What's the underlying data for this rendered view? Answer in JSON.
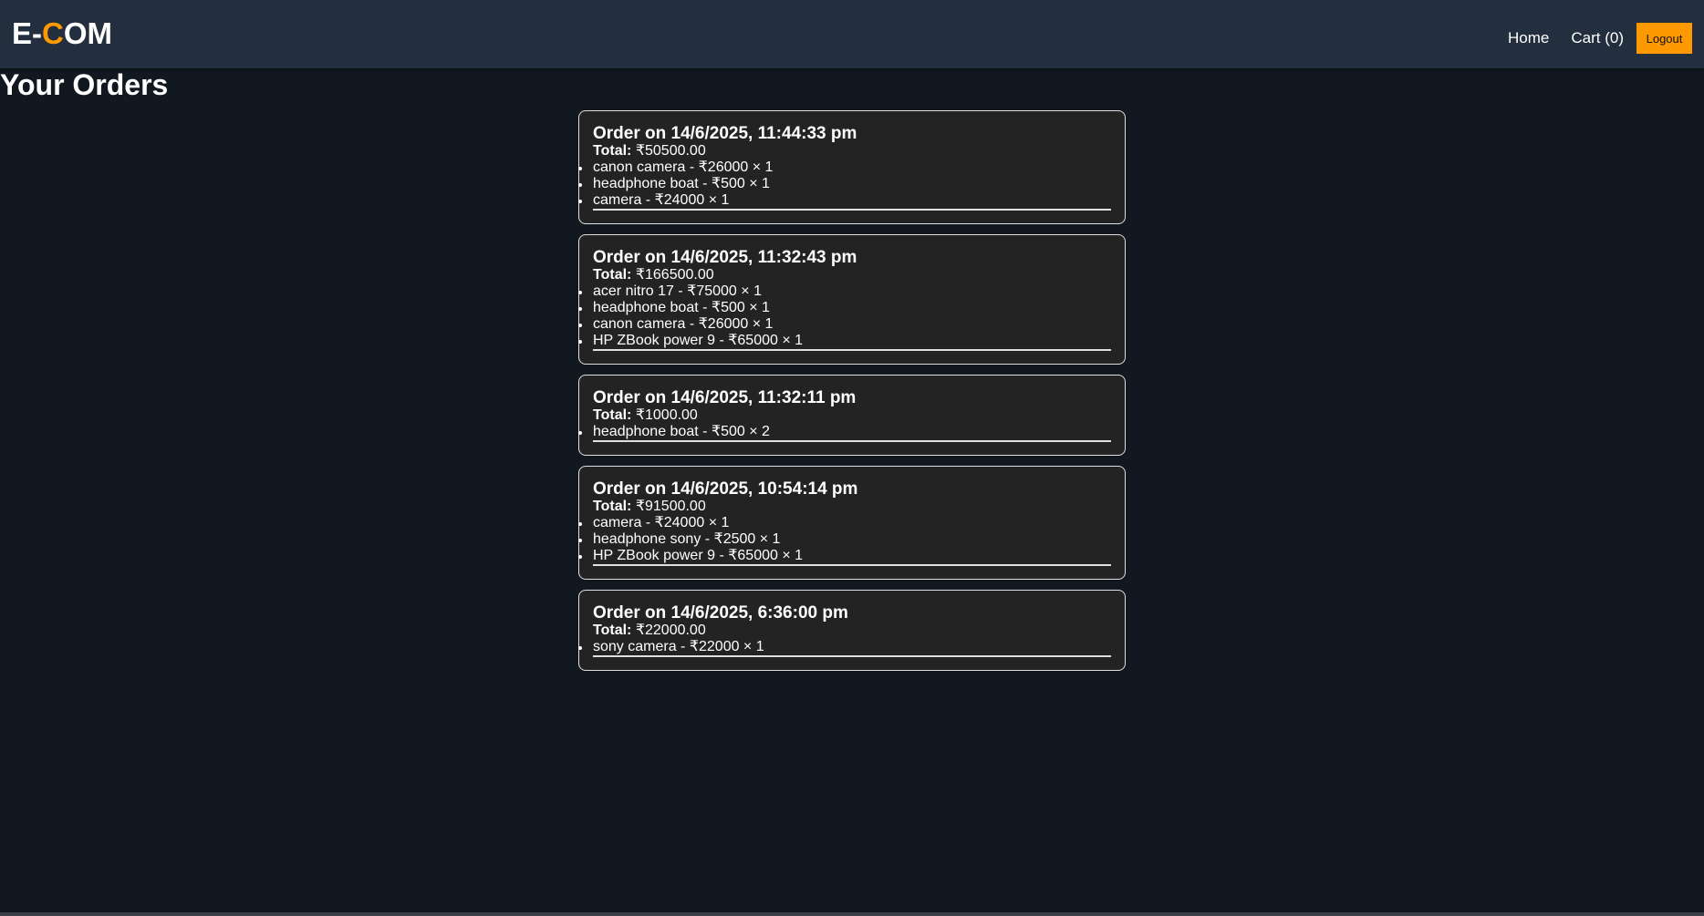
{
  "header": {
    "logo_part1": "E-",
    "logo_accent": "C",
    "logo_part2": "OM",
    "nav": {
      "home": "Home",
      "cart": "Cart (0)",
      "logout": "Logout"
    }
  },
  "colors": {
    "background": "#121820",
    "header": "#232f3e",
    "accent": "#ff9900",
    "card": "#232323"
  },
  "page": {
    "title": "Your Orders"
  },
  "orders": [
    {
      "title": "Order on 14/6/2025, 11:44:33 pm",
      "total_label": "Total:",
      "total": "₹50500.00",
      "items": [
        "canon camera - ₹26000 × 1",
        "headphone boat - ₹500 × 1",
        "camera - ₹24000 × 1"
      ]
    },
    {
      "title": "Order on 14/6/2025, 11:32:43 pm",
      "total_label": "Total:",
      "total": "₹166500.00",
      "items": [
        "acer nitro 17 - ₹75000 × 1",
        "headphone boat - ₹500 × 1",
        "canon camera - ₹26000 × 1",
        "HP ZBook power 9 - ₹65000 × 1"
      ]
    },
    {
      "title": "Order on 14/6/2025, 11:32:11 pm",
      "total_label": "Total:",
      "total": "₹1000.00",
      "items": [
        "headphone boat - ₹500 × 2"
      ]
    },
    {
      "title": "Order on 14/6/2025, 10:54:14 pm",
      "total_label": "Total:",
      "total": "₹91500.00",
      "items": [
        "camera - ₹24000 × 1",
        "headphone sony - ₹2500 × 1",
        "HP ZBook power 9 - ₹65000 × 1"
      ]
    },
    {
      "title": "Order on 14/6/2025, 6:36:00 pm",
      "total_label": "Total:",
      "total": "₹22000.00",
      "items": [
        "sony camera - ₹22000 × 1"
      ]
    }
  ]
}
